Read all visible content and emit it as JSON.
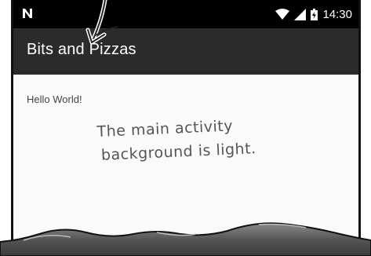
{
  "status_bar": {
    "time": "14:30",
    "icons": [
      "android-n-icon",
      "wifi-icon",
      "cell-signal-icon",
      "battery-icon"
    ]
  },
  "toolbar": {
    "title": "Bits and Pizzas"
  },
  "main": {
    "text": "Hello World!"
  },
  "annotation": {
    "line1": "The main activity",
    "line2": "background is light."
  },
  "colors": {
    "status_bar": "#000000",
    "toolbar": "#2b2b2b",
    "background": "#fafafa"
  }
}
